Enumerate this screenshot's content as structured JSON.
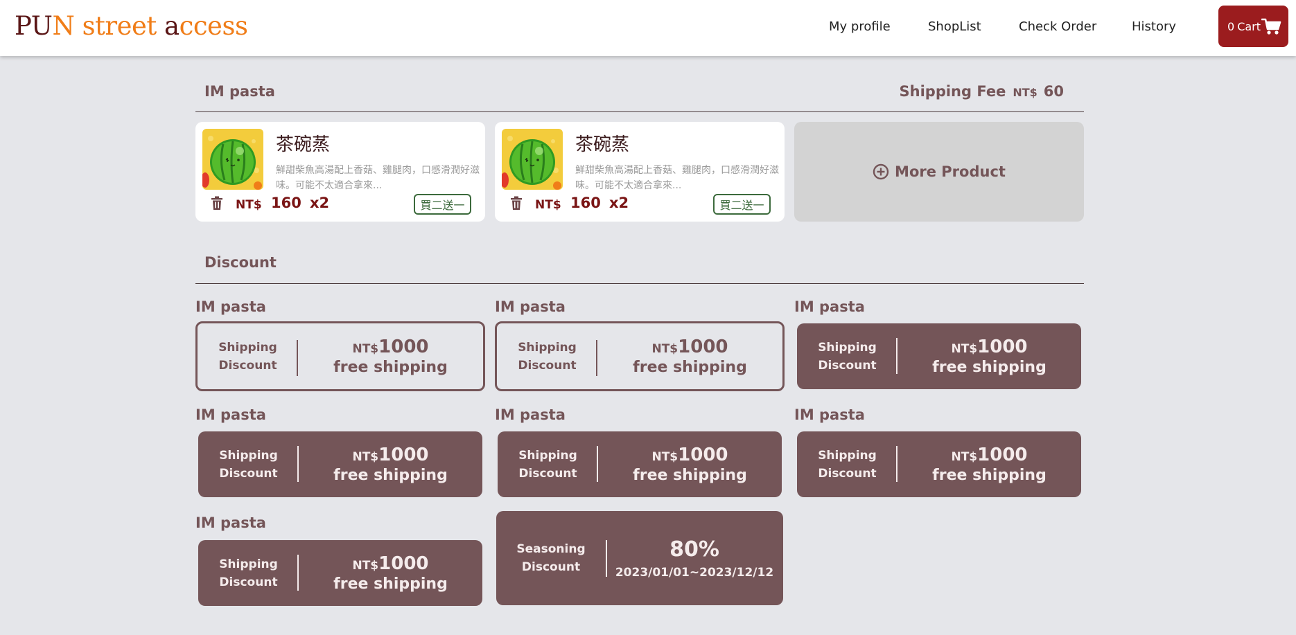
{
  "header": {
    "logo_parts": [
      "PU",
      "N street ",
      "a",
      "ccess"
    ],
    "nav": [
      "My profile",
      "ShopList",
      "Check Order",
      "History"
    ],
    "cart_count": "0",
    "cart_label": "Cart"
  },
  "order": {
    "store": "IM pasta",
    "shipping_fee_label": "Shipping Fee",
    "currency": "NT$",
    "shipping_fee_value": "60",
    "products": [
      {
        "name": "茶碗蒸",
        "description": "鮮甜柴魚高湯配上香菇、雞腿肉，口感滑潤好滋味。可能不太適合拿來...",
        "currency": "NT$",
        "price": "160",
        "qty": "x2",
        "promo": "買二送一"
      },
      {
        "name": "茶碗蒸",
        "description": "鮮甜柴魚高湯配上香菇、雞腿肉，口感滑潤好滋味。可能不太適合拿來...",
        "currency": "NT$",
        "price": "160",
        "qty": "x2",
        "promo": "買二送一"
      }
    ],
    "more_product_label": "More Product"
  },
  "discount": {
    "title": "Discount",
    "coupons": [
      {
        "store": "IM pasta",
        "type_line1": "Shipping",
        "type_line2": "Discount",
        "currency": "NT$",
        "amount": "1000",
        "desc": "free shipping",
        "style": "outline"
      },
      {
        "store": "IM pasta",
        "type_line1": "Shipping",
        "type_line2": "Discount",
        "currency": "NT$",
        "amount": "1000",
        "desc": "free shipping",
        "style": "outline"
      },
      {
        "store": "IM pasta",
        "type_line1": "Shipping",
        "type_line2": "Discount",
        "currency": "NT$",
        "amount": "1000",
        "desc": "free shipping",
        "style": "filled"
      },
      {
        "store": "IM pasta",
        "type_line1": "Shipping",
        "type_line2": "Discount",
        "currency": "NT$",
        "amount": "1000",
        "desc": "free shipping",
        "style": "filled"
      },
      {
        "store": "IM pasta",
        "type_line1": "Shipping",
        "type_line2": "Discount",
        "currency": "NT$",
        "amount": "1000",
        "desc": "free shipping",
        "style": "filled"
      },
      {
        "store": "IM pasta",
        "type_line1": "Shipping",
        "type_line2": "Discount",
        "currency": "NT$",
        "amount": "1000",
        "desc": "free shipping",
        "style": "filled"
      },
      {
        "store": "IM pasta",
        "type_line1": "Shipping",
        "type_line2": "Discount",
        "currency": "NT$",
        "amount": "1000",
        "desc": "free shipping",
        "style": "filled"
      }
    ],
    "seasoning": {
      "type_line1": "Seasoning",
      "type_line2": "Discount",
      "percent": "80%",
      "period": "2023/01/01~2023/12/12"
    }
  },
  "colors": {
    "brand_dark": "#5a1616",
    "brand_orange": "#f07d18",
    "cart": "#9b1c1e",
    "accent": "#745558",
    "price": "#7a1515",
    "promo": "#3c6a3c",
    "background": "#e5e6ea"
  },
  "icons": [
    "cart-icon",
    "trash-icon",
    "plus-circle-icon",
    "watermelon-product-image"
  ]
}
